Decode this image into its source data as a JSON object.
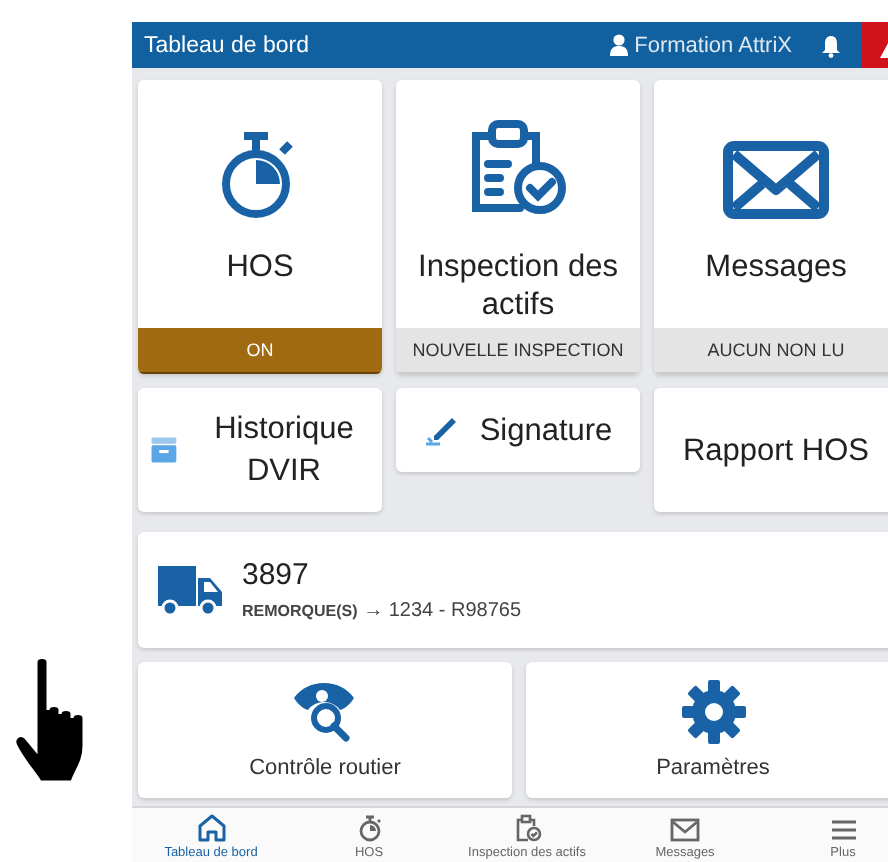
{
  "header": {
    "title": "Tableau de bord",
    "user": "Formation AttriX"
  },
  "tiles": [
    {
      "label": "HOS",
      "status": "ON",
      "active": true
    },
    {
      "label": "Inspection des actifs",
      "status": "NOUVELLE INSPECTION",
      "active": false
    },
    {
      "label": "Messages",
      "status": "AUCUN NON LU",
      "active": false
    }
  ],
  "shortcuts": [
    {
      "label": "Historique DVIR"
    },
    {
      "label": "Signature"
    },
    {
      "label": "Rapport HOS"
    }
  ],
  "vehicle": {
    "number": "3897",
    "trailers_label": "REMORQUE(S)",
    "trailers": "→ 1234 - R98765"
  },
  "actions": [
    {
      "label": "Contrôle routier"
    },
    {
      "label": "Paramètres"
    }
  ],
  "nav": [
    {
      "label": "Tableau de bord",
      "selected": true
    },
    {
      "label": "HOS",
      "selected": false
    },
    {
      "label": "Inspection des actifs",
      "selected": false
    },
    {
      "label": "Messages",
      "selected": false
    },
    {
      "label": "Plus",
      "selected": false
    }
  ]
}
